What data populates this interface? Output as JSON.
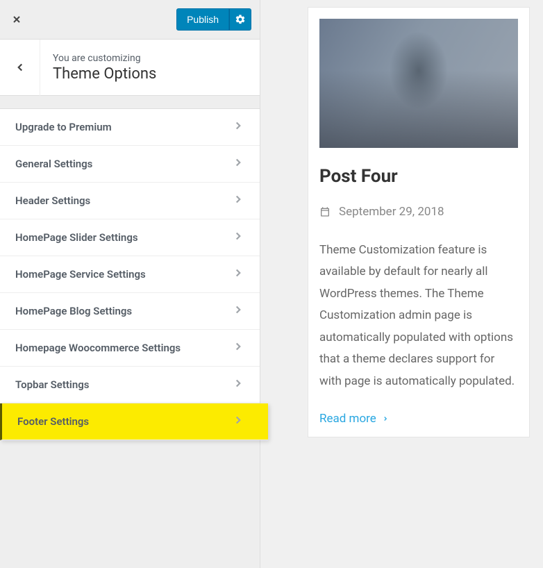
{
  "topbar": {
    "publish_label": "Publish"
  },
  "header": {
    "subtitle": "You are customizing",
    "title": "Theme Options"
  },
  "menu": {
    "items": [
      {
        "label": "Upgrade to Premium",
        "highlighted": false
      },
      {
        "label": "General Settings",
        "highlighted": false
      },
      {
        "label": "Header Settings",
        "highlighted": false
      },
      {
        "label": "HomePage Slider Settings",
        "highlighted": false
      },
      {
        "label": "HomePage Service Settings",
        "highlighted": false
      },
      {
        "label": "HomePage Blog Settings",
        "highlighted": false
      },
      {
        "label": "Homepage Woocommerce Settings",
        "highlighted": false
      },
      {
        "label": "Topbar Settings",
        "highlighted": false
      },
      {
        "label": "Footer Settings",
        "highlighted": true
      }
    ]
  },
  "preview": {
    "post": {
      "title": "Post Four",
      "date": "September 29, 2018",
      "excerpt": "Theme Customization feature is available by default for nearly all WordPress themes. The Theme Customization admin page is automatically populated with options that a theme declares support for with page is automatically populated.",
      "read_more": "Read more"
    }
  }
}
